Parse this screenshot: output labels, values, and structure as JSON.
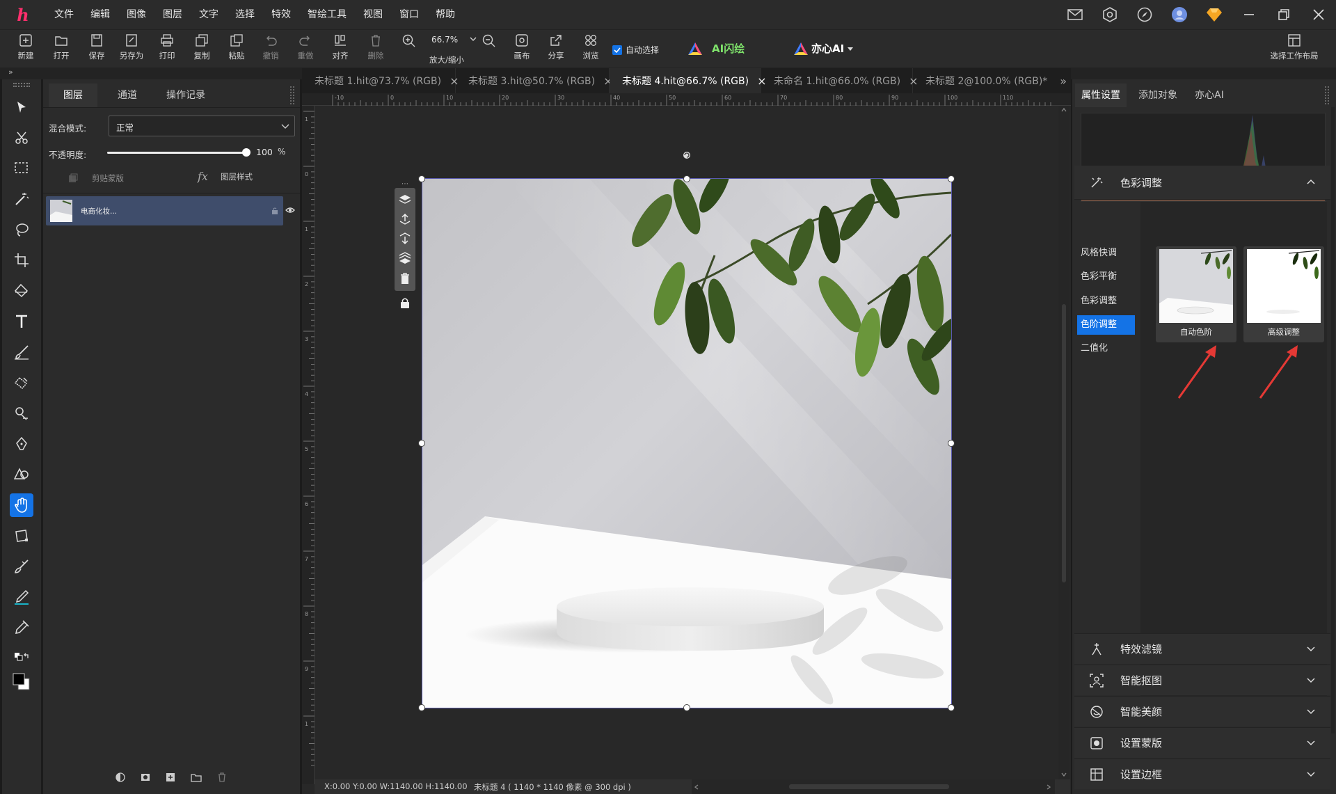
{
  "app": {
    "logo": "h"
  },
  "menu": [
    "文件",
    "编辑",
    "图像",
    "图层",
    "文字",
    "选择",
    "特效",
    "智绘工具",
    "视图",
    "窗口",
    "帮助"
  ],
  "toolbar": {
    "new": "新建",
    "open": "打开",
    "save": "保存",
    "save_as": "另存为",
    "print": "打印",
    "copy": "复制",
    "paste": "粘贴",
    "undo": "撤销",
    "redo": "重做",
    "align": "对齐",
    "delete": "删除",
    "zoom_value": "66.7%",
    "zoom_label": "放大/缩小",
    "canvas": "画布",
    "share": "分享",
    "browse": "浏览",
    "auto_select": "自动选择",
    "ai_flash": "AI闪绘",
    "yixin_ai": "亦心AI",
    "workspace": "选择工作布局"
  },
  "doc_tabs": [
    {
      "label": "未标题 1.hit@73.7% (RGB)",
      "close": "×"
    },
    {
      "label": "未标题 3.hit@50.7% (RGB)",
      "close": "×"
    },
    {
      "label": "未标题 4.hit@66.7% (RGB)",
      "close": "×"
    },
    {
      "label": "未命名 1.hit@66.0% (RGB)",
      "close": "×"
    },
    {
      "label": "未标题 2@100.0% (RGB)*",
      "close": "»"
    }
  ],
  "layers_panel": {
    "tabs": [
      "图层",
      "通道",
      "操作记录"
    ],
    "blend_label": "混合模式:",
    "blend_value": "正常",
    "opacity_label": "不透明度:",
    "opacity_value": "100",
    "opacity_unit": "%",
    "opacity_fraction": 1.0,
    "clip_mask": "剪贴蒙版",
    "fx": "fx",
    "layer_style": "图层样式",
    "layer_name": "电商化妆..."
  },
  "ruler_h": [
    "-10",
    "0",
    "10",
    "20",
    "30",
    "40",
    "50",
    "60",
    "70",
    "80",
    "90",
    "100",
    "110"
  ],
  "ruler_v": [
    "1",
    "0",
    "1",
    "2",
    "3",
    "4",
    "5",
    "6",
    "7",
    "8",
    "9",
    "1"
  ],
  "status": {
    "coords": "X:0.00 Y:0.00 W:1140.00 H:1140.00",
    "doc": "未标题 4 ( 1140 * 1140 像素 @ 300 dpi )"
  },
  "right_panel": {
    "tabs": [
      "属性设置",
      "添加对象",
      "亦心AI"
    ],
    "color_adjust": "色彩调整",
    "sub_items": [
      "风格快调",
      "色彩平衡",
      "色彩调整",
      "色阶调整",
      "二值化"
    ],
    "active_sub": 3,
    "thumbs": [
      "自动色阶",
      "高级调整"
    ],
    "sections": [
      "特效滤镜",
      "智能抠图",
      "智能美颜",
      "设置蒙版",
      "设置边框"
    ]
  },
  "colors": {
    "accent": "#1473e6",
    "logo": "#ff2f6d",
    "arrow": "#e53935"
  }
}
